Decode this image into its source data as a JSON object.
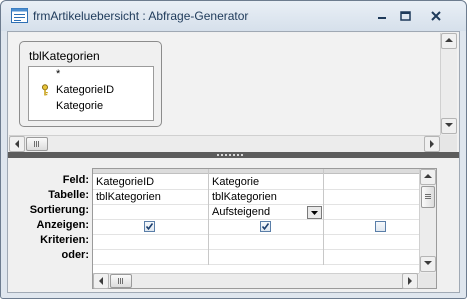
{
  "window": {
    "title": "frmArtikeluebersicht : Abfrage-Generator",
    "icon": "query-icon",
    "controls": [
      "minimize-icon",
      "restore-icon",
      "close-icon"
    ]
  },
  "table_pane": {
    "table_name": "tblKategorien",
    "fields": [
      {
        "name": "*",
        "primary_key": false
      },
      {
        "name": "KategorieID",
        "primary_key": true
      },
      {
        "name": "Kategorie",
        "primary_key": false
      }
    ]
  },
  "design_grid": {
    "row_labels": {
      "field": "Feld:",
      "table": "Tabelle:",
      "sort": "Sortierung:",
      "show": "Anzeigen:",
      "criteria": "Kriterien:",
      "or": "oder:"
    },
    "columns": [
      {
        "field": "KategorieID",
        "table": "tblKategorien",
        "sort": "",
        "show": true,
        "criteria": "",
        "or": ""
      },
      {
        "field": "Kategorie",
        "table": "tblKategorien",
        "sort": "Aufsteigend",
        "show": true,
        "criteria": "",
        "or": ""
      },
      {
        "field": "",
        "table": "",
        "sort": "",
        "show": false,
        "criteria": "",
        "or": ""
      }
    ]
  },
  "colors": {
    "titlebar": "#dfe6ee",
    "checkbox_border": "#5a7ea8",
    "splitter": "#5c5c5c"
  }
}
